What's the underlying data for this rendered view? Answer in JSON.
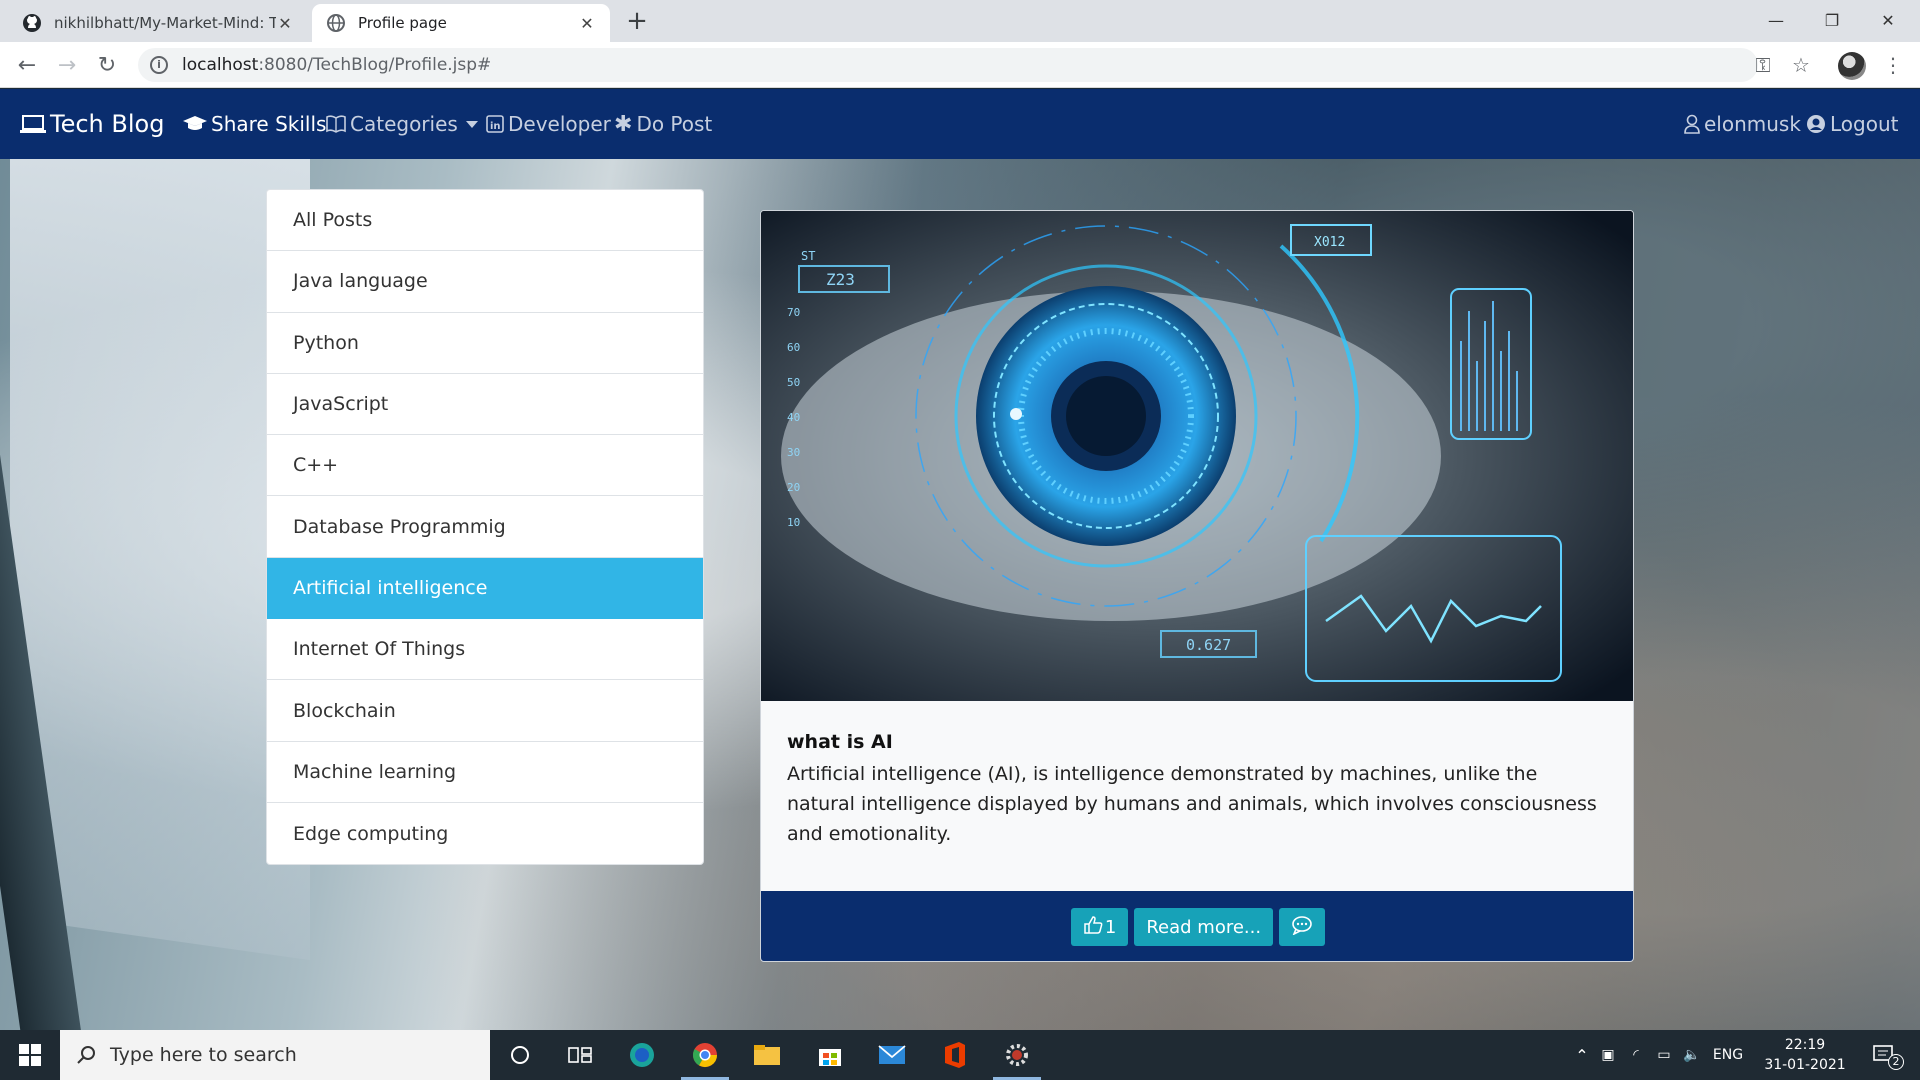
{
  "browser": {
    "tabs": [
      {
        "title": "nikhilbhatt/My-Market-Mind: Thi",
        "icon": "github-icon",
        "active": false
      },
      {
        "title": "Profile page",
        "icon": "globe-icon",
        "active": true
      }
    ],
    "new_tab": "+",
    "url": {
      "host": "localhost",
      "rest": ":8080/TechBlog/Profile.jsp#"
    }
  },
  "navbar": {
    "brand": "Tech Blog",
    "links": [
      {
        "label": "Share Skills",
        "icon": "graduation-cap-icon"
      },
      {
        "label": "Categories",
        "icon": "book-icon",
        "dropdown": true
      },
      {
        "label": "Developer",
        "icon": "linkedin-icon"
      },
      {
        "label": "Do Post",
        "icon": "asterisk-icon"
      }
    ],
    "user": "elonmusk",
    "logout": "Logout"
  },
  "categories": {
    "items": [
      "All Posts",
      "Java language",
      "Python",
      "JavaScript",
      "C++",
      "Database Programmig",
      "Artificial intelligence",
      "Internet Of Things",
      "Blockchain",
      "Machine learning",
      "Edge computing"
    ],
    "active": "Artificial intelligence"
  },
  "post": {
    "title": "what is AI",
    "content": "Artificial intelligence (AI), is intelligence demonstrated by machines, unlike the natural intelligence displayed by humans and animals, which involves consciousness and emotionality.",
    "likes": "1",
    "read_more": "Read more...",
    "image_labels": {
      "top_left": "Z23",
      "top_right": "X012",
      "bottom": "0.627",
      "corner": "ST",
      "scale": [
        "70",
        "60",
        "50",
        "40",
        "30",
        "20",
        "10"
      ]
    }
  },
  "taskbar": {
    "search_placeholder": "Type here to search",
    "language": "ENG",
    "time": "22:19",
    "date": "31-01-2021",
    "notifications": "2"
  },
  "colors": {
    "navbar": "#0a2d6e",
    "active_category": "#31b5e6",
    "button": "#17a2b8"
  }
}
